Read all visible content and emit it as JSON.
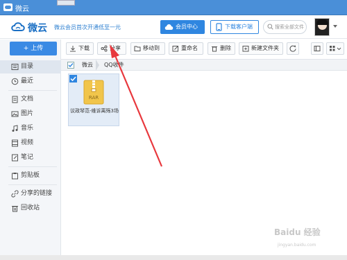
{
  "titlebar": {
    "title": "微云"
  },
  "header": {
    "logo_text": "微云",
    "promo": "微云会员首次开通低至一元",
    "vip_label": "会员中心",
    "client_label": "下载客户端",
    "search_placeholder": "搜索全部文件"
  },
  "sidebar": {
    "upload_label": "+ 上传",
    "items": [
      {
        "label": "目录",
        "icon": "folder-icon"
      },
      {
        "label": "最近",
        "icon": "clock-icon"
      },
      {
        "label": "文档",
        "icon": "document-icon"
      },
      {
        "label": "图片",
        "icon": "image-icon"
      },
      {
        "label": "音乐",
        "icon": "music-icon"
      },
      {
        "label": "视频",
        "icon": "video-icon"
      },
      {
        "label": "笔记",
        "icon": "note-icon"
      },
      {
        "label": "剪贴板",
        "icon": "clipboard-icon"
      },
      {
        "label": "分享的链接",
        "icon": "link-icon"
      },
      {
        "label": "回收站",
        "icon": "trash-icon"
      }
    ]
  },
  "toolbar": {
    "download": "下载",
    "share": "分享",
    "move": "移动到",
    "rename": "重命名",
    "delete": "删除",
    "new_folder": "新建文件夹"
  },
  "breadcrumb": {
    "root": "微云",
    "current": "QQ收件"
  },
  "files": [
    {
      "name": "议政琴范-维诉离殇3场",
      "type": "RAR",
      "selected": true
    }
  ],
  "colors": {
    "accent": "#2f86e0",
    "annotation_arrow": "#e8383d"
  },
  "watermark": {
    "text": "Baidu 经验",
    "sub": "jingyan.baidu.com"
  }
}
